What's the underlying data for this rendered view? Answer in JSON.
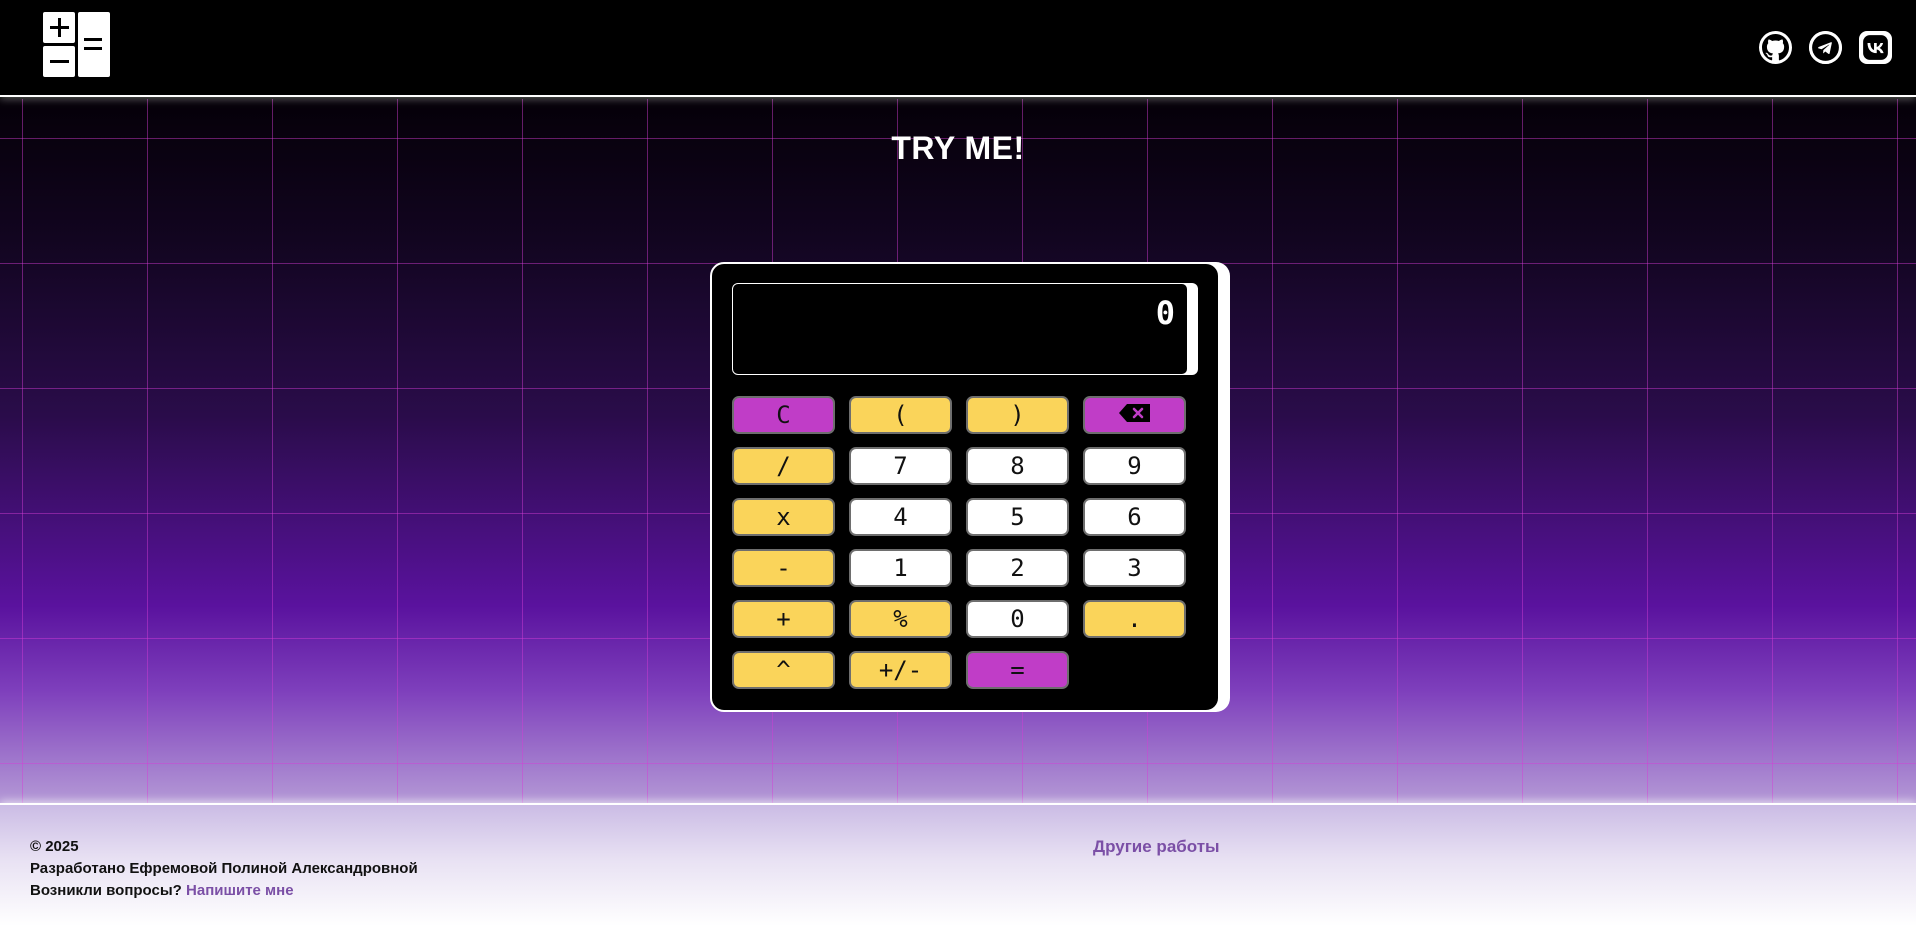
{
  "header": {
    "logo_icon": "calculator-logo-icon",
    "socials": [
      {
        "name": "github-icon"
      },
      {
        "name": "telegram-icon"
      },
      {
        "name": "vk-icon"
      }
    ]
  },
  "main": {
    "title": "TRY ME!"
  },
  "calculator": {
    "display_value": "0",
    "keys": [
      {
        "label": "C",
        "style": "magenta",
        "name": "clear-button"
      },
      {
        "label": "(",
        "style": "yellow",
        "name": "open-paren-button"
      },
      {
        "label": ")",
        "style": "yellow",
        "name": "close-paren-button"
      },
      {
        "label": "",
        "style": "magenta",
        "name": "backspace-button"
      },
      {
        "label": "/",
        "style": "yellow",
        "name": "divide-button"
      },
      {
        "label": "7",
        "style": "white",
        "name": "digit-7-button"
      },
      {
        "label": "8",
        "style": "white",
        "name": "digit-8-button"
      },
      {
        "label": "9",
        "style": "white",
        "name": "digit-9-button"
      },
      {
        "label": "x",
        "style": "yellow",
        "name": "multiply-button"
      },
      {
        "label": "4",
        "style": "white",
        "name": "digit-4-button"
      },
      {
        "label": "5",
        "style": "white",
        "name": "digit-5-button"
      },
      {
        "label": "6",
        "style": "white",
        "name": "digit-6-button"
      },
      {
        "label": "-",
        "style": "yellow",
        "name": "subtract-button"
      },
      {
        "label": "1",
        "style": "white",
        "name": "digit-1-button"
      },
      {
        "label": "2",
        "style": "white",
        "name": "digit-2-button"
      },
      {
        "label": "3",
        "style": "white",
        "name": "digit-3-button"
      },
      {
        "label": "+",
        "style": "yellow",
        "name": "add-button"
      },
      {
        "label": "%",
        "style": "yellow",
        "name": "percent-button"
      },
      {
        "label": "0",
        "style": "white",
        "name": "digit-0-button"
      },
      {
        "label": ".",
        "style": "yellow",
        "name": "decimal-button"
      },
      {
        "label": "^",
        "style": "yellow",
        "name": "power-button"
      },
      {
        "label": "+/-",
        "style": "yellow",
        "name": "negate-button"
      },
      {
        "label": "=",
        "style": "magenta",
        "name": "equals-button"
      }
    ]
  },
  "footer": {
    "copyright": "© 2025",
    "developed_by": "Разработано Ефремовой Полиной Александровной",
    "questions": "Возникли вопросы?",
    "contact_link": "Напишите мне",
    "other_works": "Другие работы"
  },
  "colors": {
    "yellow": "#fad45a",
    "magenta": "#c03dc7",
    "link": "#7b4fa6",
    "grid": "#d63cd6"
  }
}
